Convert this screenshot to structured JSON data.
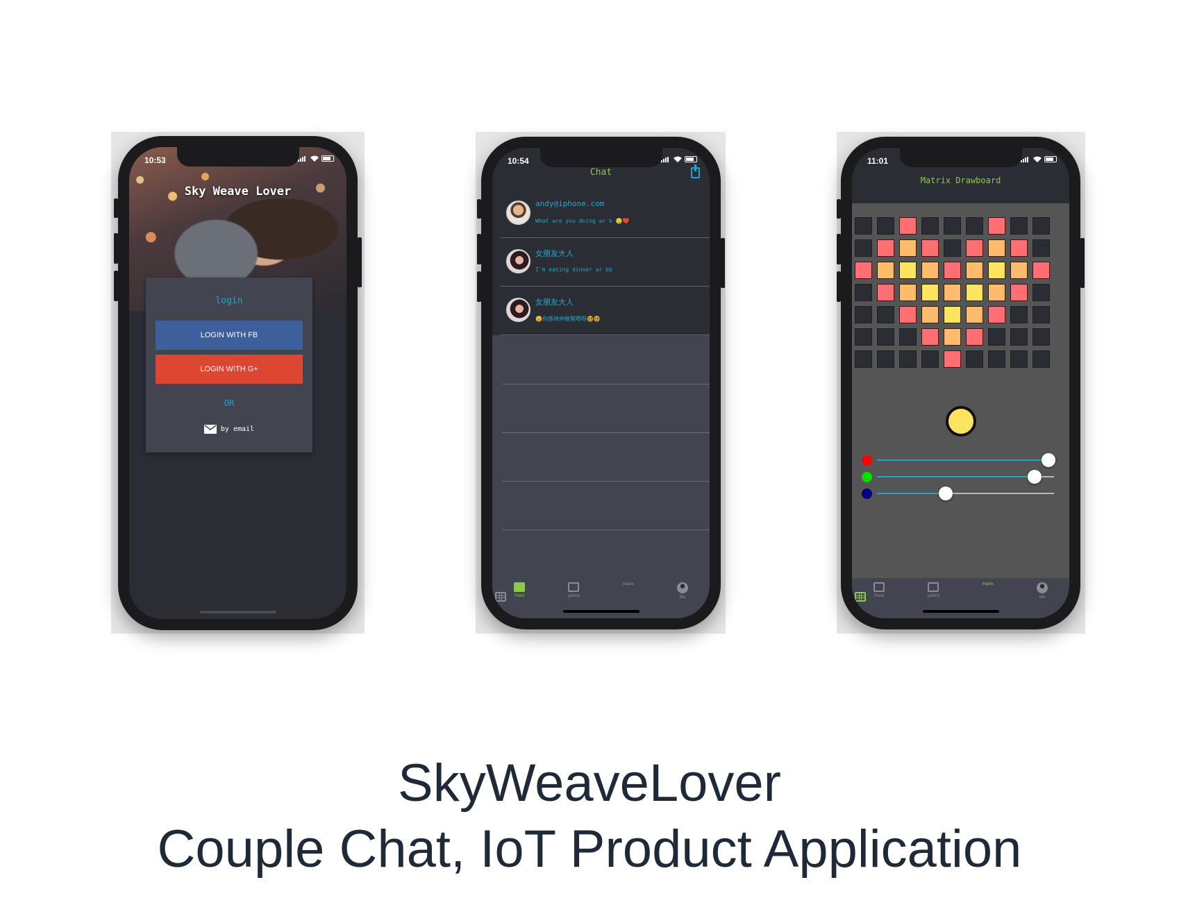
{
  "phones": {
    "login": {
      "time": "10:53",
      "app_title": "Sky Weave Lover",
      "card_title": "login",
      "fb_label": "LOGIN WITH FB",
      "gplus_label": "LOGIN WITH G+",
      "or_label": "OR",
      "email_label": "by email",
      "icons": [
        "mail-icon",
        "wifi-icon",
        "signal-icon",
        "battery-icon"
      ],
      "colors": {
        "fb": "#3d5f9b",
        "gplus": "#dd4731",
        "accent": "#23a6c6",
        "card": "#42454f"
      }
    },
    "chat": {
      "time": "10:54",
      "title": "Chat",
      "conversations": [
        {
          "name": "andy@iphone.com",
          "message": "What are you doing ar b 😏❤️",
          "avatar": "male-avatar"
        },
        {
          "name": "女朋友大人",
          "message": "I'm eating dinner ar bb",
          "avatar": "female-avatar"
        },
        {
          "name": "女朋友大人",
          "message": "😉你係咪仲做緊嘢呀🤓🤓",
          "avatar": "female-avatar"
        }
      ],
      "colors": {
        "title": "#8cc84b",
        "text": "#23a6c6"
      }
    },
    "matrix": {
      "time": "11:01",
      "title": "Matrix Drawboard",
      "grid": [
        [
          "d",
          "d",
          "r",
          "d",
          "d",
          "d",
          "r",
          "d",
          "d"
        ],
        [
          "d",
          "r",
          "o",
          "r",
          "d",
          "r",
          "o",
          "r",
          "d"
        ],
        [
          "r",
          "o",
          "y",
          "o",
          "r",
          "o",
          "y",
          "o",
          "r"
        ],
        [
          "d",
          "r",
          "o",
          "y",
          "o",
          "y",
          "o",
          "r",
          "d"
        ],
        [
          "d",
          "d",
          "r",
          "o",
          "y",
          "o",
          "r",
          "d",
          "d"
        ],
        [
          "d",
          "d",
          "d",
          "r",
          "o",
          "r",
          "d",
          "d",
          "d"
        ],
        [
          "d",
          "d",
          "d",
          "d",
          "r",
          "d",
          "d",
          "d",
          "d"
        ]
      ],
      "cell_colors": {
        "d": "#2b2d35",
        "r": "#fc6f73",
        "o": "#fdbb6b",
        "y": "#fde460"
      },
      "selected_color": "#fde460",
      "sliders": [
        {
          "channel": "red",
          "color": "#ff0000",
          "value": 0.97
        },
        {
          "channel": "green",
          "color": "#00dd00",
          "value": 0.89
        },
        {
          "channel": "blue",
          "color": "#000080",
          "value": 0.39
        }
      ]
    }
  },
  "tabs": [
    {
      "label": "Feed",
      "icon": "feed-icon"
    },
    {
      "label": "gallery",
      "icon": "gallery-icon"
    },
    {
      "label": "matrix",
      "icon": "matrix-icon"
    },
    {
      "label": "Me",
      "icon": "user-icon"
    }
  ],
  "caption": {
    "line1": "SkyWeaveLover",
    "line2": "Couple Chat, IoT Product Application"
  }
}
